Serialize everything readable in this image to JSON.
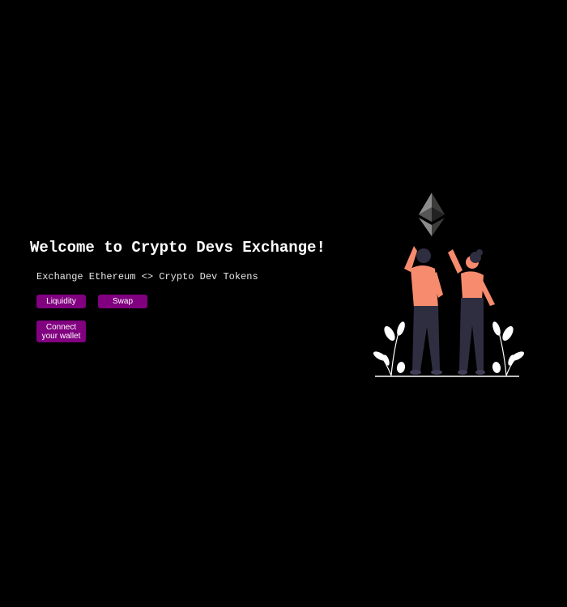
{
  "header": {
    "title": "Welcome to Crypto Devs Exchange!",
    "description": "Exchange Ethereum <> Crypto Dev Tokens"
  },
  "actions": {
    "liquidity_label": "Liquidity",
    "swap_label": "Swap",
    "connect_label": "Connect your wallet"
  },
  "illustration": {
    "icon": "ethereum-logo-icon",
    "subject": "celebrating-people-illustration"
  },
  "colors": {
    "background": "#000000",
    "text": "#ffffff",
    "button": "#800080",
    "skin_shirt": "#f78b6e",
    "pants": "#2f2e41",
    "eth_dark": "#3c3c3b",
    "eth_light": "#8c8c8c"
  }
}
